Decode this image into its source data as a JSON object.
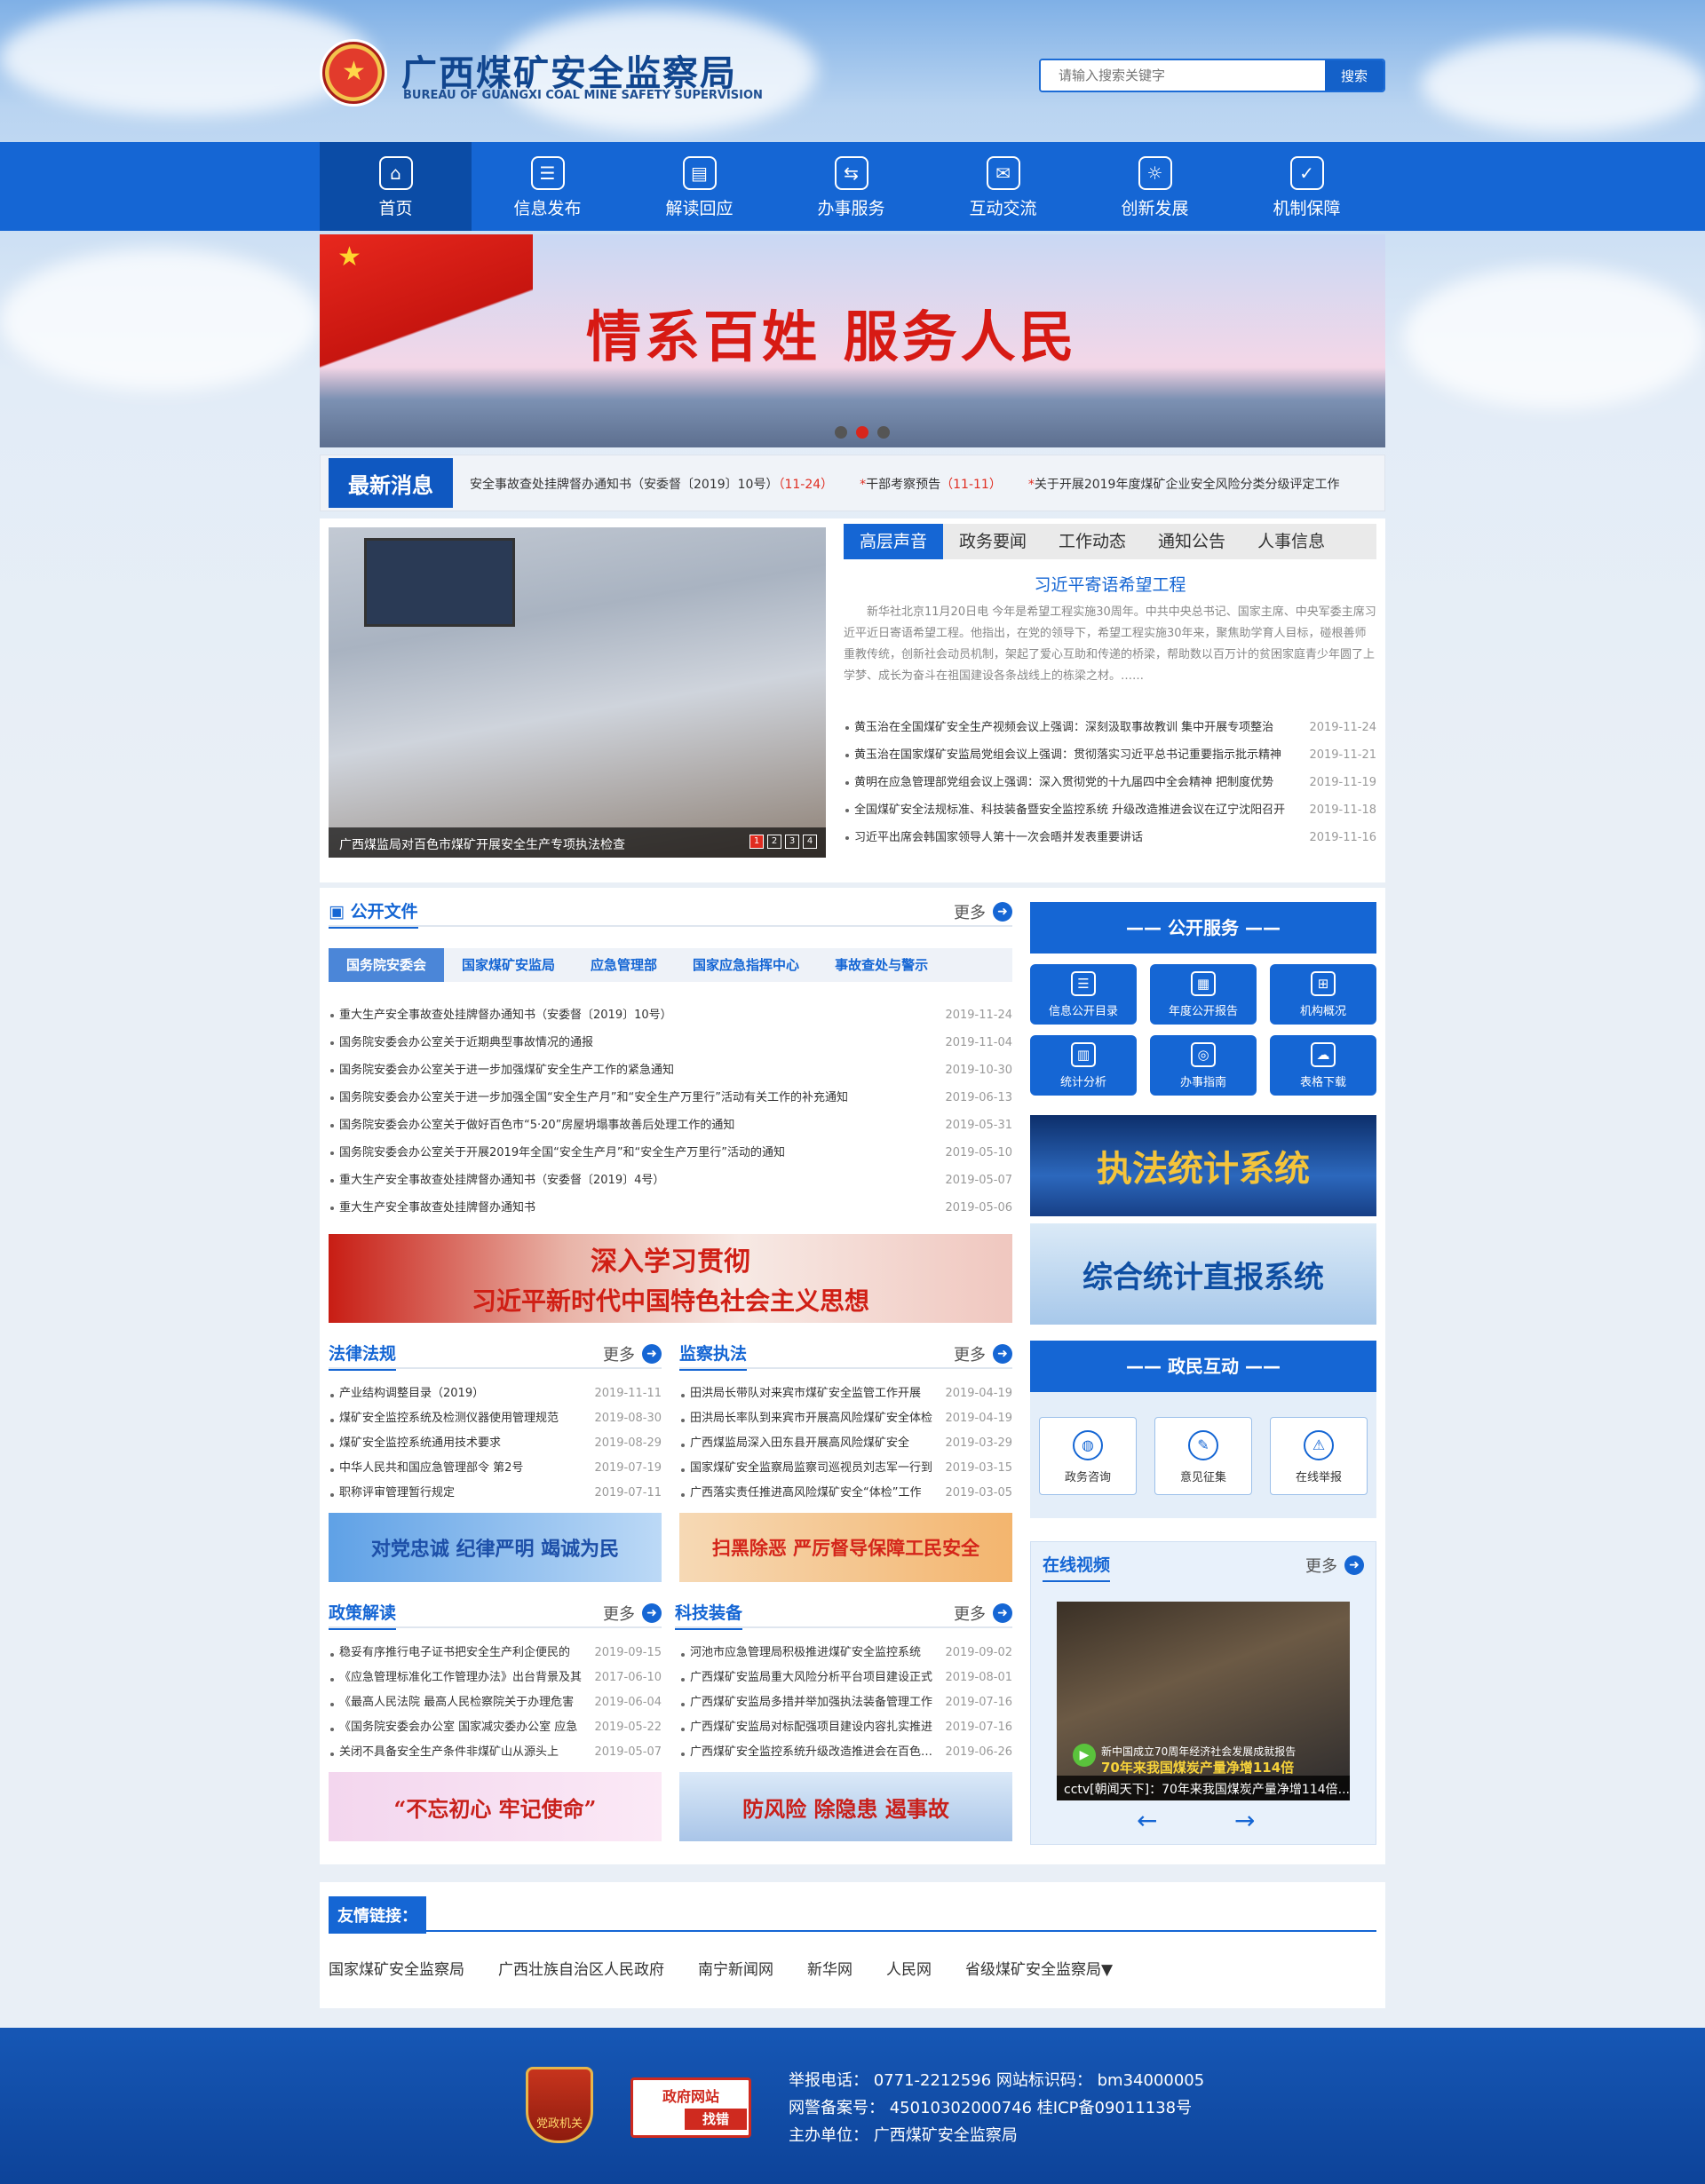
{
  "header": {
    "title": "广西煤矿安全监察局",
    "subtitle": "BUREAU OF GUANGXI COAL MINE SAFETY SUPERVISION",
    "search_placeholder": "请输入搜索关键字",
    "search_button": "搜索"
  },
  "nav": [
    {
      "label": "首页",
      "icon": "home-icon"
    },
    {
      "label": "信息发布",
      "icon": "document-icon"
    },
    {
      "label": "解读回应",
      "icon": "book-icon"
    },
    {
      "label": "办事服务",
      "icon": "service-icon"
    },
    {
      "label": "互动交流",
      "icon": "chat-icon"
    },
    {
      "label": "创新发展",
      "icon": "bulb-icon"
    },
    {
      "label": "机制保障",
      "icon": "shield-icon"
    }
  ],
  "banner": {
    "slogan": "情系百姓  服务人民"
  },
  "ticker": {
    "label": "最新消息",
    "items": [
      {
        "text": "安全事故查处挂牌督办通知书（安委督〔2019〕10号）",
        "date": "（11-24）"
      },
      {
        "text": "干部考察预告",
        "date": "（11-11）"
      },
      {
        "text": "关于开展2019年度煤矿企业安全风险分类分级评定工作"
      }
    ]
  },
  "photo": {
    "caption": "广西煤监局对百色市煤矿开展安全生产专项执法检查",
    "pages": [
      "1",
      "2",
      "3",
      "4"
    ]
  },
  "news_tabs": [
    "高层声音",
    "政务要闻",
    "工作动态",
    "通知公告",
    "人事信息"
  ],
  "feature": {
    "title": "习近平寄语希望工程",
    "text": "新华社北京11月20日电 今年是希望工程实施30周年。中共中央总书记、国家主席、中央军委主席习近平近日寄语希望工程。他指出，在党的领导下，希望工程实施30年来，聚焦助学育人目标，碰根善师重教传统，创新社会动员机制，架起了爱心互助和传递的桥梁，帮助数以百万计的贫困家庭青少年圆了上学梦、成长为奋斗在祖国建设各条战线上的栋梁之材。……"
  },
  "news_list": [
    {
      "title": "黄玉治在全国煤矿安全生产视频会议上强调：深刻汲取事故教训 集中开展专项整治",
      "date": "2019-11-24"
    },
    {
      "title": "黄玉治在国家煤矿安监局党组会议上强调：贯彻落实习近平总书记重要指示批示精神",
      "date": "2019-11-21"
    },
    {
      "title": "黄明在应急管理部党组会议上强调：深入贯彻党的十九届四中全会精神 把制度优势",
      "date": "2019-11-19"
    },
    {
      "title": "全国煤矿安全法规标准、科技装备暨安全监控系统 升级改造推进会议在辽宁沈阳召开",
      "date": "2019-11-18"
    },
    {
      "title": "习近平出席会韩国家领导人第十一次会晤并发表重要讲话",
      "date": "2019-11-16"
    }
  ],
  "public_docs": {
    "title": "公开文件",
    "more": "更多",
    "tabs": [
      "国务院安委会",
      "国家煤矿安监局",
      "应急管理部",
      "国家应急指挥中心",
      "事故查处与警示"
    ],
    "items": [
      {
        "title": "重大生产安全事故查处挂牌督办通知书（安委督〔2019〕10号）",
        "date": "2019-11-24"
      },
      {
        "title": "国务院安委会办公室关于近期典型事故情况的通报",
        "date": "2019-11-04"
      },
      {
        "title": "国务院安委会办公室关于进一步加强煤矿安全生产工作的紧急通知",
        "date": "2019-10-30"
      },
      {
        "title": "国务院安委会办公室关于进一步加强全国“安全生产月”和“安全生产万里行”活动有关工作的补充通知",
        "date": "2019-06-13"
      },
      {
        "title": "国务院安委会办公室关于做好百色市“5·20”房屋坍塌事故善后处理工作的通知",
        "date": "2019-05-31"
      },
      {
        "title": "国务院安委会办公室关于开展2019年全国“安全生产月”和“安全生产万里行”活动的通知",
        "date": "2019-05-10"
      },
      {
        "title": "重大生产安全事故查处挂牌督办通知书（安委督〔2019〕4号）",
        "date": "2019-05-07"
      },
      {
        "title": "重大生产安全事故查处挂牌督办通知书",
        "date": "2019-05-06"
      }
    ]
  },
  "study_banner": {
    "line1": "深入学习贯彻",
    "line2": "习近平新时代中国特色社会主义思想"
  },
  "laws": {
    "title": "法律法规",
    "more": "更多",
    "items": [
      {
        "title": "产业结构调整目录（2019）",
        "date": "2019-11-11"
      },
      {
        "title": "煤矿安全监控系统及检测仪器使用管理规范",
        "date": "2019-08-30"
      },
      {
        "title": "煤矿安全监控系统通用技术要求",
        "date": "2019-08-29"
      },
      {
        "title": "中华人民共和国应急管理部令 第2号",
        "date": "2019-07-19"
      },
      {
        "title": "职称评审管理暂行规定",
        "date": "2019-07-11"
      }
    ]
  },
  "supervision": {
    "title": "监察执法",
    "more": "更多",
    "items": [
      {
        "title": "田洪局长带队对来宾市煤矿安全监管工作开展",
        "date": "2019-04-19"
      },
      {
        "title": "田洪局长率队到来宾市开展高风险煤矿安全体检",
        "date": "2019-04-19"
      },
      {
        "title": "广西煤监局深入田东县开展高风险煤矿安全",
        "date": "2019-03-29"
      },
      {
        "title": "国家煤矿安全监察局监察司巡视员刘志军一行到",
        "date": "2019-03-15"
      },
      {
        "title": "广西落实责任推进高风险煤矿安全“体检”工作",
        "date": "2019-03-05"
      }
    ]
  },
  "ban_left": "对党忠诚 纪律严明 竭诚为民",
  "ban_right": "扫黑除恶 严厉督导保障工民安全",
  "policy": {
    "title": "政策解读",
    "more": "更多",
    "items": [
      {
        "title": "稳妥有序推行电子证书把安全生产利企便民的",
        "date": "2019-09-15"
      },
      {
        "title": "《应急管理标准化工作管理办法》出台背景及其",
        "date": "2017-06-10"
      },
      {
        "title": "《最高人民法院 最高人民检察院关于办理危害",
        "date": "2019-06-04"
      },
      {
        "title": "《国务院安委会办公室 国家减灾委办公室 应急",
        "date": "2019-05-22"
      },
      {
        "title": "关闭不具备安全生产条件非煤矿山从源头上",
        "date": "2019-05-07"
      }
    ]
  },
  "tech": {
    "title": "科技装备",
    "more": "更多",
    "items": [
      {
        "title": "河池市应急管理局积极推进煤矿安全监控系统",
        "date": "2019-09-02"
      },
      {
        "title": "广西煤矿安监局重大风险分析平台项目建设正式",
        "date": "2019-08-01"
      },
      {
        "title": "广西煤矿安监局多措并举加强执法装备管理工作",
        "date": "2019-07-16"
      },
      {
        "title": "广西煤矿安监局对标配强项目建设内容扎实推进",
        "date": "2019-07-16"
      },
      {
        "title": "广西煤矿安全监控系统升级改造推进会在百色召开",
        "date": "2019-06-26"
      }
    ]
  },
  "ban_bottom_left": "“不忘初心 牢记使命”",
  "ban_bottom_right": "防风险 除隐患 遏事故",
  "services": {
    "title": "—— 公开服务 ——",
    "items": [
      {
        "label": "信息公开目录",
        "icon": "catalog-icon"
      },
      {
        "label": "年度公开报告",
        "icon": "calendar-icon"
      },
      {
        "label": "机构概况",
        "icon": "org-chart-icon"
      },
      {
        "label": "统计分析",
        "icon": "bar-chart-icon"
      },
      {
        "label": "办事指南",
        "icon": "compass-icon"
      },
      {
        "label": "表格下载",
        "icon": "cloud-download-icon"
      }
    ]
  },
  "sys_banner1": "执法统计系统",
  "sys_banner2": "综合统计直报系统",
  "interaction": {
    "title": "—— 政民互动 ——",
    "items": [
      {
        "label": "政务咨询",
        "icon": "globe-icon"
      },
      {
        "label": "意见征集",
        "icon": "clipboard-icon"
      },
      {
        "label": "在线举报",
        "icon": "alarm-icon"
      }
    ]
  },
  "video": {
    "title": "在线视频",
    "more": "更多",
    "overlay": "新中国成立70周年经济社会发展成就报告",
    "overlay2": "70年来我国煤炭产量净增114倍",
    "caption": "cctv[朝闻天下]：70年来我国煤炭产量净增114倍..."
  },
  "links": {
    "title": "友情链接：",
    "items": [
      "国家煤矿安全监察局",
      "广西壮族自治区人民政府",
      "南宁新闻网",
      "新华网",
      "人民网",
      "省级煤矿安全监察局"
    ]
  },
  "footer": {
    "line1": "举报电话：  0771-2212596    网站标识码： bm34000005",
    "line2": "网警备案号：  45010302000746    桂ICP备09011138号",
    "line3": "主办单位：  广西煤矿安全监察局",
    "badge1": "党政机关",
    "badge2_top": "政府网站",
    "badge2_bottom": "找错"
  }
}
